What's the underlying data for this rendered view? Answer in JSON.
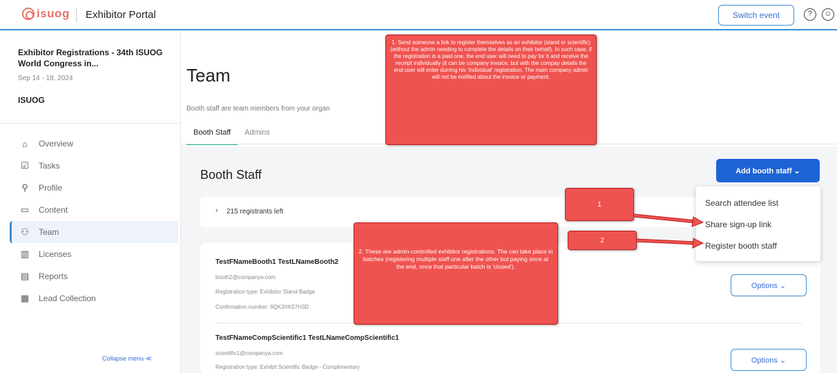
{
  "header": {
    "logo_text": "isuog",
    "portal_title": "Exhibitor Portal",
    "switch_event_label": "Switch event",
    "help_icon": "question-circle-icon",
    "account_icon": "user-circle-icon",
    "accent_color": "#3b8fd6",
    "brand_color": "#e8736a"
  },
  "sidebar": {
    "event_title": "Exhibitor Registrations - 34th ISUOG World Congress in...",
    "event_date": "Sep 14 - 18, 2024",
    "org_name": "ISUOG",
    "items": [
      {
        "label": "Overview",
        "icon": "home-icon"
      },
      {
        "label": "Tasks",
        "icon": "checkbox-icon"
      },
      {
        "label": "Profile",
        "icon": "person-icon"
      },
      {
        "label": "Content",
        "icon": "folder-icon"
      },
      {
        "label": "Team",
        "icon": "team-icon",
        "active": true
      },
      {
        "label": "Licenses",
        "icon": "barcode-icon"
      },
      {
        "label": "Reports",
        "icon": "chart-icon"
      },
      {
        "label": "Lead Collection",
        "icon": "clipboard-icon"
      }
    ],
    "collapse_label": "Collapse menu ≪"
  },
  "main": {
    "title": "Team",
    "description": "Booth staff are team members from your organ",
    "tabs": [
      {
        "label": "Booth Staff",
        "active": true
      },
      {
        "label": "Admins",
        "active": false
      }
    ],
    "section_title": "Booth Staff",
    "add_button_label": "Add booth staff ⌄",
    "registrants_left": "215 registrants left",
    "staff": [
      {
        "name": "TestFNameBooth1 TestLNameBooth2",
        "email": "booth2@companya.com",
        "reg_type": "Registration type: Exhibitor Stand Badge",
        "confirmation": "Confirmation number: 9QK3XK57H3D",
        "options_label": "Options ⌄"
      },
      {
        "name": "TestFNameCompScientific1 TestLNameCompScientific1",
        "email": "scientific1@companya.com",
        "reg_type": "Registration type: Exhibit Scientific Badge - Complimentary",
        "options_label": "Options ⌄"
      }
    ]
  },
  "dropdown": {
    "items": [
      "Search attendee list",
      "Share sign-up link",
      "Register booth staff"
    ]
  },
  "annotations": {
    "note1": "1. Send someone a link to register themselves as an exhibitor (stand or scientific) (without the admin needing to complete the details on their behalf). In such case, if the registration is a paid one, the end user will need to pay for it and receive the receipt individually (it can be company invoice, but with the compay details the end user will enter durring his 'individual' registration. The main company admin will not be notified about the invoice or payment.",
    "note2": "2. These are admin-controlled exhibitor registrations. The can take place in batches (registering multiple staff one after the other but paying once at the end, once that particular batch is 'closed').",
    "num1": "1",
    "num2": "2",
    "color": "#ef5350"
  }
}
